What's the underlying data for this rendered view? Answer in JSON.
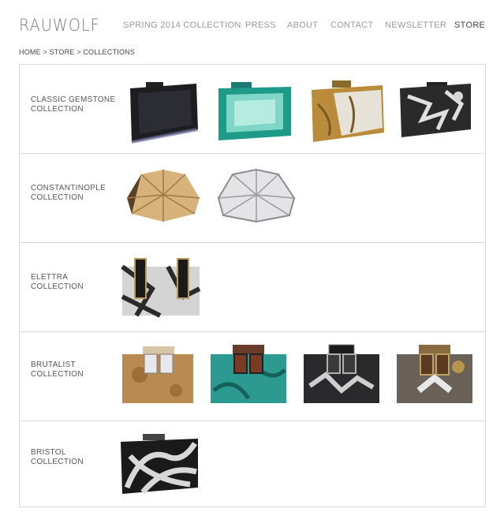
{
  "brand": {
    "logo": "RAUWOLF"
  },
  "nav": [
    {
      "label": "SPRING 2014 COLLECTION"
    },
    {
      "label": "PRESS"
    },
    {
      "label": "ABOUT"
    },
    {
      "label": "CONTACT"
    },
    {
      "label": "NEWSLETTER"
    },
    {
      "label": "STORE",
      "active": true
    }
  ],
  "breadcrumb": "HOME > STORE > COLLECTIONS",
  "collections": [
    {
      "line1": "CLASSIC GEMSTONE",
      "line2": "COLLECTION",
      "products": [
        "black-faceted-clutch",
        "emerald-faceted-clutch",
        "gold-foil-clutch",
        "silver-foil-black-clutch"
      ]
    },
    {
      "line1": "CONSTANTINOPLE",
      "line2": "COLLECTION",
      "products": [
        "gold-constantinople-clutch",
        "silver-constantinople-clutch"
      ]
    },
    {
      "line1": "ELETTRA",
      "line2": "COLLECTION",
      "products": [
        "elettra-marble-clutch"
      ]
    },
    {
      "line1": "BRUTALIST",
      "line2": "COLLECTION",
      "products": [
        "brutalist-burlwood-clutch",
        "brutalist-turquoise-clutch",
        "brutalist-black-clutch",
        "brutalist-gold-clutch"
      ]
    },
    {
      "line1": "BRISTOL",
      "line2": "COLLECTION",
      "products": [
        "bristol-black-white-clutch"
      ]
    }
  ]
}
